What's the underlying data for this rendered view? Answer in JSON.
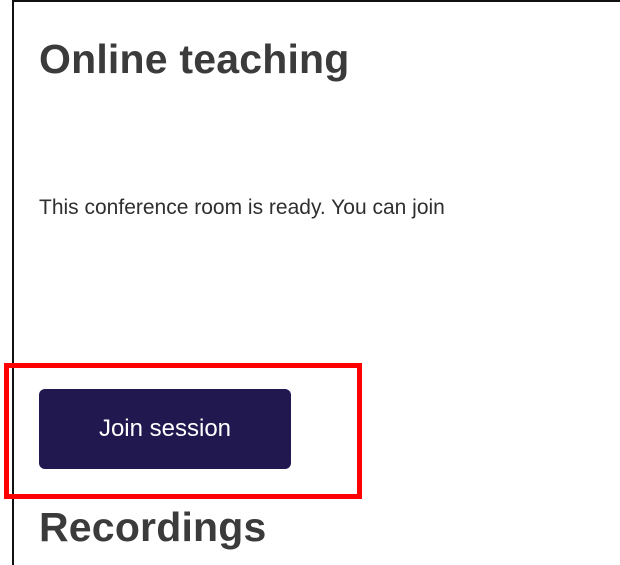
{
  "page": {
    "title": "Online teaching",
    "status_message": "This conference room is ready. You can join",
    "join_button_label": "Join session",
    "recordings_heading": "Recordings"
  },
  "colors": {
    "button_background": "#21184f",
    "highlight_border": "#ff0000"
  }
}
